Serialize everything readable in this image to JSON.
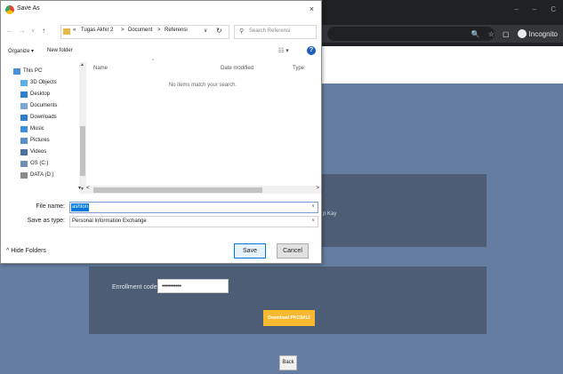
{
  "browser": {
    "incognito_label": "Incognito",
    "window_controls": [
      "–",
      "–",
      "C"
    ]
  },
  "page": {
    "card1_partial_text": "p Kay",
    "enrollment_label": "Enrollment code",
    "enrollment_value": "•••••••••••",
    "download_label": "Download PKCS#12",
    "back_label": "Back"
  },
  "dialog": {
    "title": "Save As",
    "close_icon": "×",
    "nav_buttons": [
      "←",
      "→",
      "∨",
      "↑"
    ],
    "breadcrumb": [
      "«",
      "Tugas Akhir 2",
      ">",
      "Document",
      ">",
      "Referensi"
    ],
    "refresh_icon": "↻",
    "search_placeholder": "Search Referensi",
    "toolbar": {
      "organize": "Organize ▾",
      "new_folder": "New folder",
      "view_icon": "☷ ▾",
      "help": "?"
    },
    "nav_items": [
      {
        "label": "This PC",
        "icon": "computer-icon",
        "color": "#4a90d9"
      },
      {
        "label": "3D Objects",
        "icon": "cube-icon",
        "color": "#5ab0e8"
      },
      {
        "label": "Desktop",
        "icon": "desktop-icon",
        "color": "#2f7fd1"
      },
      {
        "label": "Documents",
        "icon": "documents-icon",
        "color": "#7aa7d6"
      },
      {
        "label": "Downloads",
        "icon": "download-icon",
        "color": "#2f7fd1"
      },
      {
        "label": "Music",
        "icon": "music-icon",
        "color": "#3a8fde"
      },
      {
        "label": "Pictures",
        "icon": "pictures-icon",
        "color": "#5b8fc9"
      },
      {
        "label": "Videos",
        "icon": "videos-icon",
        "color": "#4d6fa3"
      },
      {
        "label": "OS (C:)",
        "icon": "drive-icon",
        "color": "#6f8fb3"
      },
      {
        "label": "DATA (D:)",
        "icon": "drive-icon",
        "color": "#8a8a8a"
      }
    ],
    "columns": {
      "name": "Name",
      "date": "Date modified",
      "type": "Type"
    },
    "empty_message": "No items match your search.",
    "file_name_label": "File name:",
    "file_name_value": "ashton",
    "save_as_type_label": "Save as type:",
    "save_as_type_value": "Personal Information Exchange",
    "hide_folders": "^ Hide Folders",
    "save_button": "Save",
    "cancel_button": "Cancel"
  }
}
